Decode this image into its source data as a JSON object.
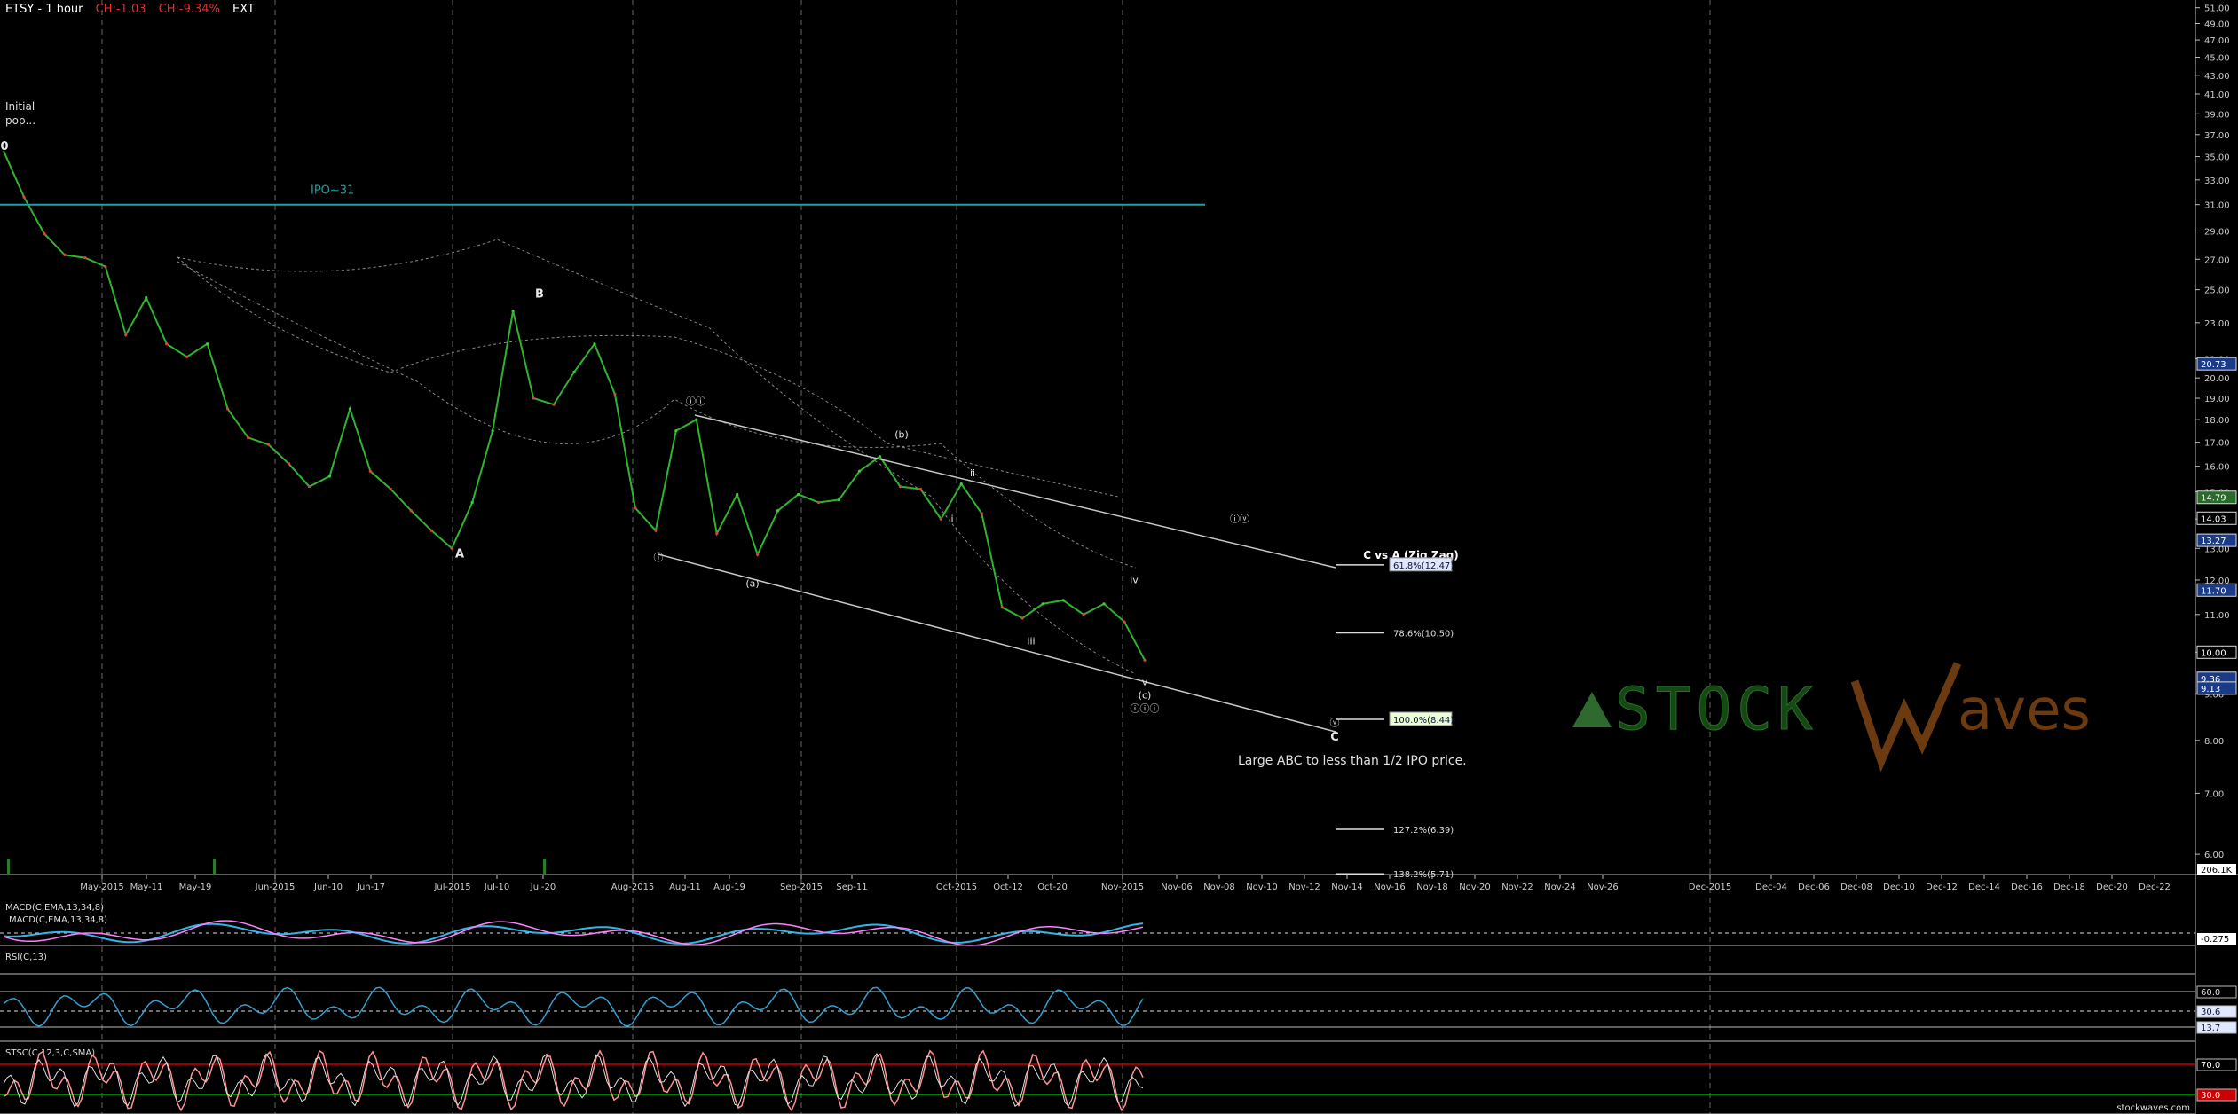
{
  "header": {
    "symbol": "ETSY - 1 hour",
    "change_abs": "CH:-1.03",
    "change_pct": "CH:-9.34%",
    "session": "EXT"
  },
  "colors": {
    "background": "#000000",
    "grid": "#666666",
    "channel": "#c8c8c8",
    "ipo_line": "#1aa3a3",
    "macd_line": "#ff80ff",
    "macd_signal": "#33b5e5",
    "rsi_line": "#33a0d0",
    "stoch_k": "#ff9090",
    "stoch_d": "#e0e0e0",
    "overbought": "#cc0000",
    "oversold": "#00aa00",
    "watermark_green": "#2e6a2e",
    "watermark_brown": "#6b3a10"
  },
  "chart_data": {
    "type": "line",
    "title": "ETSY - 1 hour",
    "xlabel": "",
    "ylabel": "",
    "y_scale": "log",
    "ylim": [
      5.7,
      52
    ],
    "grid": true,
    "x_ticks": [
      "May-2015",
      "May-11",
      "May-19",
      "Jun-2015",
      "Jun-10",
      "Jun-17",
      "Jul-2015",
      "Jul-10",
      "Jul-20",
      "Aug-2015",
      "Aug-11",
      "Aug-19",
      "Sep-2015",
      "Sep-11",
      "Oct-2015",
      "Oct-12",
      "Oct-20",
      "Nov-2015",
      "Nov-06",
      "Nov-08",
      "Nov-10",
      "Nov-12",
      "Nov-14",
      "Nov-16",
      "Nov-18",
      "Nov-20",
      "Nov-22",
      "Nov-24",
      "Nov-26",
      "Dec-2015",
      "Dec-04",
      "Dec-06",
      "Dec-08",
      "Dec-10",
      "Dec-12",
      "Dec-14",
      "Dec-16",
      "Dec-18",
      "Dec-20",
      "Dec-22"
    ],
    "y_ticks": [
      "51.00",
      "49.00",
      "47.00",
      "45.00",
      "43.00",
      "41.00",
      "39.00",
      "37.00",
      "35.00",
      "33.00",
      "31.00",
      "29.00",
      "27.00",
      "25.00",
      "23.00",
      "21.00",
      "20.00",
      "19.00",
      "18.00",
      "17.00",
      "16.00",
      "15.00",
      "14.00",
      "13.00",
      "12.00",
      "11.00",
      "10.00",
      "9.00",
      "8.00",
      "7.00",
      "6.00"
    ],
    "price_tags": [
      "20.73",
      "14.79",
      "14.03",
      "13.27",
      "11.70",
      "10.00",
      "9.36",
      "9.13"
    ],
    "volume_tag": "206.1K",
    "series": [
      {
        "values": [
          35.5,
          31.6,
          28.8,
          27.3,
          27.1,
          26.5,
          22.3,
          24.5,
          21.8,
          21.1,
          21.8,
          18.5,
          17.2,
          16.9,
          16.1,
          15.2,
          15.6,
          18.5,
          15.8,
          15.1,
          14.3,
          13.6,
          13.0,
          14.6,
          17.5,
          23.7,
          19.0,
          18.7,
          20.3,
          21.8,
          19.2,
          14.4,
          13.6,
          17.5,
          18.0,
          13.5,
          14.9,
          12.8,
          14.3,
          14.9,
          14.6,
          14.7,
          15.8,
          16.4,
          15.2,
          15.1,
          14.0,
          15.3,
          14.2,
          11.2,
          10.9,
          11.3,
          11.4,
          11.0,
          11.3,
          10.8,
          9.8
        ]
      }
    ],
    "ipo_line": {
      "label": "IPO~31",
      "value": 31
    },
    "wave_labels": [
      {
        "text": "0",
        "price": 35.6
      },
      {
        "text": "A",
        "price": 12.7
      },
      {
        "text": "B",
        "price": 24.5
      },
      {
        "text": "ⓘ",
        "price": 12.6
      },
      {
        "text": "ⓘⓘ",
        "price": 18.7
      },
      {
        "text": "(a)",
        "price": 11.8
      },
      {
        "text": "(b)",
        "price": 17.2
      },
      {
        "text": "i",
        "price": 13.9
      },
      {
        "text": "ii",
        "price": 15.6
      },
      {
        "text": "iii",
        "price": 10.2
      },
      {
        "text": "iv",
        "price": 11.9
      },
      {
        "text": "v",
        "price": 9.2
      },
      {
        "text": "(c)",
        "price": 8.9
      },
      {
        "text": "ⓘⓘⓘ",
        "price": 8.6
      },
      {
        "text": "ⓘⓥ",
        "price": 13.9
      },
      {
        "text": "ⓥ",
        "price": 8.3
      },
      {
        "text": "C",
        "price": 8.0
      }
    ],
    "annotations": {
      "initial_pop": "Initial pop...",
      "zigzag_title": "C vs A (Zig Zag)",
      "note": "Large ABC to less than 1/2 IPO price."
    },
    "fib_levels": [
      {
        "label": "61.8%(12.47)",
        "value": 12.47,
        "highlight": "blue"
      },
      {
        "label": "78.6%(10.50)",
        "value": 10.5
      },
      {
        "label": "100.0%(8.44)",
        "value": 8.44,
        "highlight": "green"
      },
      {
        "label": "127.2%(6.39)",
        "value": 6.39
      },
      {
        "label": "138.2%(5.71)",
        "value": 5.71
      }
    ],
    "indicators": {
      "macd": {
        "labels": [
          "MACD(C,EMA,13,34,8)",
          "MACD(C,EMA,13,34,8)"
        ],
        "value_tag": "-0.275"
      },
      "rsi": {
        "label": "RSI(C,13)",
        "levels": [
          "60.0",
          "30.6",
          "13.7"
        ]
      },
      "stoch": {
        "label": "STSC(C,12,3,C,SMA)",
        "levels": [
          "70.0",
          "30.0"
        ]
      }
    },
    "watermark": {
      "brand": "STOCK",
      "wave_text": "aves",
      "site": "stockwaves.com"
    }
  }
}
